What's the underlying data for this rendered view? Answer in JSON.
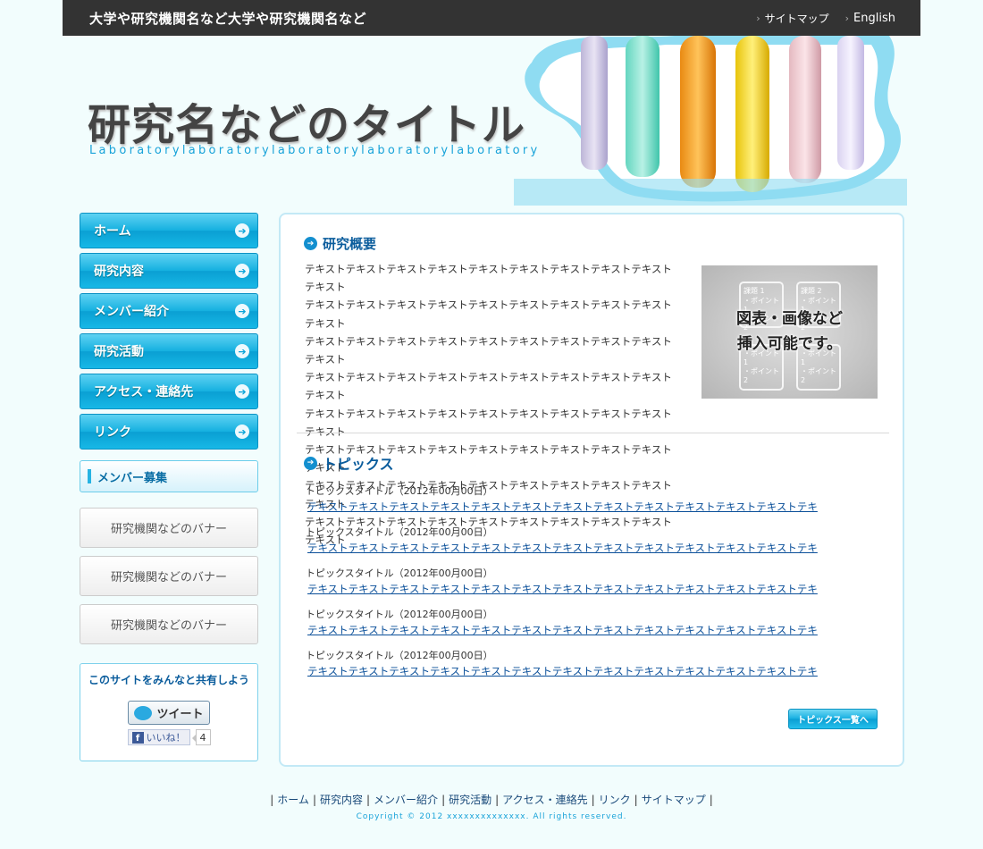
{
  "header": {
    "org_name": "大学や研究機関名など大学や研究機関名など",
    "sitemap_link": "サイトマップ",
    "english_link": "English",
    "site_title": "研究名などのタイトル",
    "site_subtitle": "Laboratorylaboratorylaboratorylaboratorylaboratory"
  },
  "nav": {
    "items": [
      {
        "label": "ホーム"
      },
      {
        "label": "研究内容"
      },
      {
        "label": "メンバー紹介"
      },
      {
        "label": "研究活動"
      },
      {
        "label": "アクセス・連絡先"
      },
      {
        "label": "リンク"
      }
    ],
    "recruit_label": "メンバー募集"
  },
  "banners": [
    "研究機関などのバナー",
    "研究機関などのバナー",
    "研究機関などのバナー"
  ],
  "share": {
    "title": "このサイトをみんなと共有しよう",
    "tweet_label": "ツイート",
    "like_label": "いいね！",
    "like_count": "4"
  },
  "overview": {
    "heading": "研究概要",
    "lines": [
      "テキストテキストテキストテキストテキストテキストテキストテキストテキストテキスト",
      "テキストテキストテキストテキストテキストテキストテキストテキストテキストテキスト",
      "テキストテキストテキストテキストテキストテキストテキストテキストテキストテキスト",
      "テキストテキストテキストテキストテキストテキストテキストテキストテキストテキスト",
      "テキストテキストテキストテキストテキストテキストテキストテキストテキストテキスト",
      "テキストテキストテキストテキストテキストテキストテキストテキストテキストテキスト",
      "テキストテキストテキストテキストテキストテキストテキストテキストテキストテキスト",
      "テキストテキストテキストテキストテキストテキストテキストテキストテキストテキスト"
    ],
    "figure_caption_1": "図表・画像など",
    "figure_caption_2": "挿入可能です。",
    "figure_boxes": [
      {
        "title": "課題 1",
        "items": [
          "・ポイント 1",
          "・ポイント 2"
        ]
      },
      {
        "title": "課題 2",
        "items": [
          "・ポイント 1",
          "・ポイント 2"
        ]
      },
      {
        "title": "",
        "items": [
          "・ポイント 1",
          "・ポイント 2"
        ]
      },
      {
        "title": "",
        "items": [
          "・ポイント 1",
          "・ポイント 2"
        ]
      }
    ]
  },
  "topics": {
    "heading": "トピックス",
    "items": [
      {
        "title": "トピックスタイトル（2012年00月00日）",
        "link": "テキストテキストテキストテキストテキストテキストテキストテキストテキストテキストテキストテキストテキ"
      },
      {
        "title": "トピックスタイトル（2012年00月00日）",
        "link": "テキストテキストテキストテキストテキストテキストテキストテキストテキストテキストテキストテキストテキ"
      },
      {
        "title": "トピックスタイトル（2012年00月00日）",
        "link": "テキストテキストテキストテキストテキストテキストテキストテキストテキストテキストテキストテキストテキ"
      },
      {
        "title": "トピックスタイトル（2012年00月00日）",
        "link": "テキストテキストテキストテキストテキストテキストテキストテキストテキストテキストテキストテキストテキ"
      },
      {
        "title": "トピックスタイトル（2012年00月00日）",
        "link": "テキストテキストテキストテキストテキストテキストテキストテキストテキストテキストテキストテキストテキ"
      }
    ],
    "more_label": "トピックス一覧へ"
  },
  "footer": {
    "links": [
      "ホーム",
      "研究内容",
      "メンバー紹介",
      "研究活動",
      "アクセス・連絡先",
      "リンク",
      "サイトマップ"
    ],
    "copyright": "Copyright © 2012 xxxxxxxxxxxxxx. All rights reserved."
  },
  "colors": {
    "accent": "#14b0e0",
    "heading_blue": "#0a5c9c",
    "topbar": "#333333",
    "background": "#f2fdfd"
  },
  "icons": [
    "chevron-right-icon",
    "arrow-circle-icon",
    "twitter-icon",
    "facebook-icon"
  ]
}
